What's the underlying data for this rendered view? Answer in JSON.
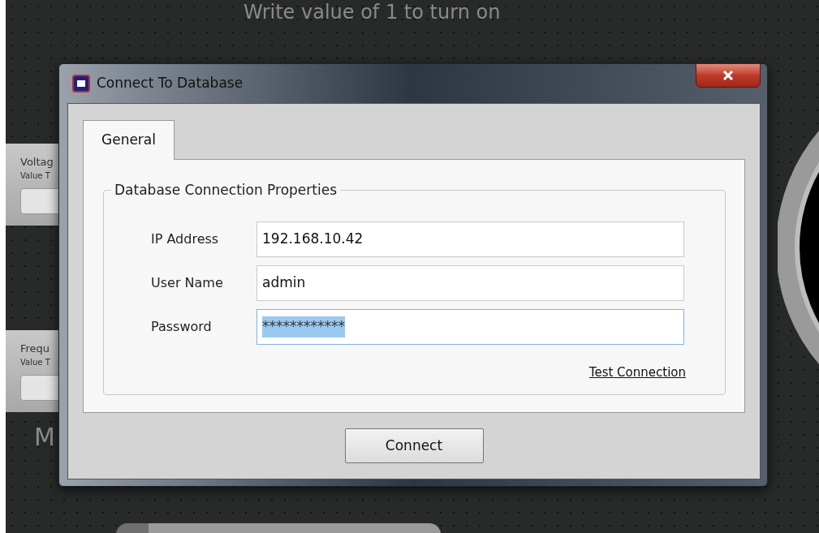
{
  "background": {
    "heading": "Write value of 1 to turn on",
    "panels": [
      {
        "title": "Voltag",
        "subtitle": "Value T"
      },
      {
        "title": "Frequ",
        "subtitle": "Value T"
      }
    ],
    "big_letter": "M"
  },
  "dialog": {
    "title": "Connect To Database",
    "tabs": [
      {
        "label": "General",
        "selected": true
      }
    ],
    "group": {
      "legend": "Database Connection Properties",
      "fields": [
        {
          "label": "IP Address",
          "value": "192.168.10.42",
          "focused": false
        },
        {
          "label": "User Name",
          "value": "admin",
          "focused": false
        },
        {
          "label": "Password",
          "value": "************",
          "focused": true
        }
      ],
      "link": "Test Connection"
    },
    "buttons": [
      "Connect"
    ]
  }
}
